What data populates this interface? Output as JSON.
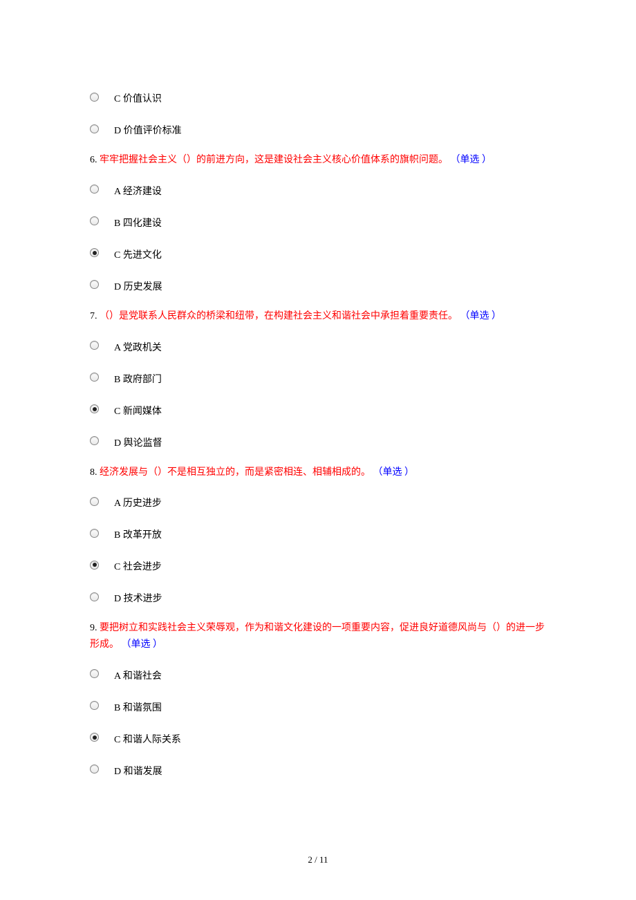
{
  "orphan_options": [
    {
      "letter": "C",
      "text": "价值认识",
      "selected": false
    },
    {
      "letter": "D",
      "text": "价值评价标准",
      "selected": false
    }
  ],
  "questions": [
    {
      "number": "6.",
      "text": "牢牢把握社会主义（）的前进方向，这是建设社会主义核心价值体系的旗帜问题。",
      "type": "（单选 ）",
      "options": [
        {
          "letter": "A",
          "text": "经济建设",
          "selected": false
        },
        {
          "letter": "B",
          "text": "四化建设",
          "selected": false
        },
        {
          "letter": "C",
          "text": "先进文化",
          "selected": true
        },
        {
          "letter": "D",
          "text": "历史发展",
          "selected": false
        }
      ]
    },
    {
      "number": "7.",
      "text": "（）是党联系人民群众的桥梁和纽带，在构建社会主义和谐社会中承担着重要责任。",
      "type": "（单选 ）",
      "options": [
        {
          "letter": "A",
          "text": "党政机关",
          "selected": false
        },
        {
          "letter": "B",
          "text": "政府部门",
          "selected": false
        },
        {
          "letter": "C",
          "text": "新闻媒体",
          "selected": true
        },
        {
          "letter": "D",
          "text": "舆论监督",
          "selected": false
        }
      ]
    },
    {
      "number": "8.",
      "text": "经济发展与（）不是相互独立的，而是紧密相连、相辅相成的。",
      "type": "（单选 ）",
      "options": [
        {
          "letter": "A",
          "text": "历史进步",
          "selected": false
        },
        {
          "letter": "B",
          "text": "改革开放",
          "selected": false
        },
        {
          "letter": "C",
          "text": "社会进步",
          "selected": true
        },
        {
          "letter": "D",
          "text": "技术进步",
          "selected": false
        }
      ]
    },
    {
      "number": "9.",
      "text": "要把树立和实践社会主义荣辱观，作为和谐文化建设的一项重要内容，促进良好道德风尚与（）的进一步形成。",
      "type": "（单选 ）",
      "options": [
        {
          "letter": "A",
          "text": "和谐社会",
          "selected": false
        },
        {
          "letter": "B",
          "text": "和谐氛围",
          "selected": false
        },
        {
          "letter": "C",
          "text": "和谐人际关系",
          "selected": true
        },
        {
          "letter": "D",
          "text": "和谐发展",
          "selected": false
        }
      ]
    }
  ],
  "footer": "2  /  11"
}
